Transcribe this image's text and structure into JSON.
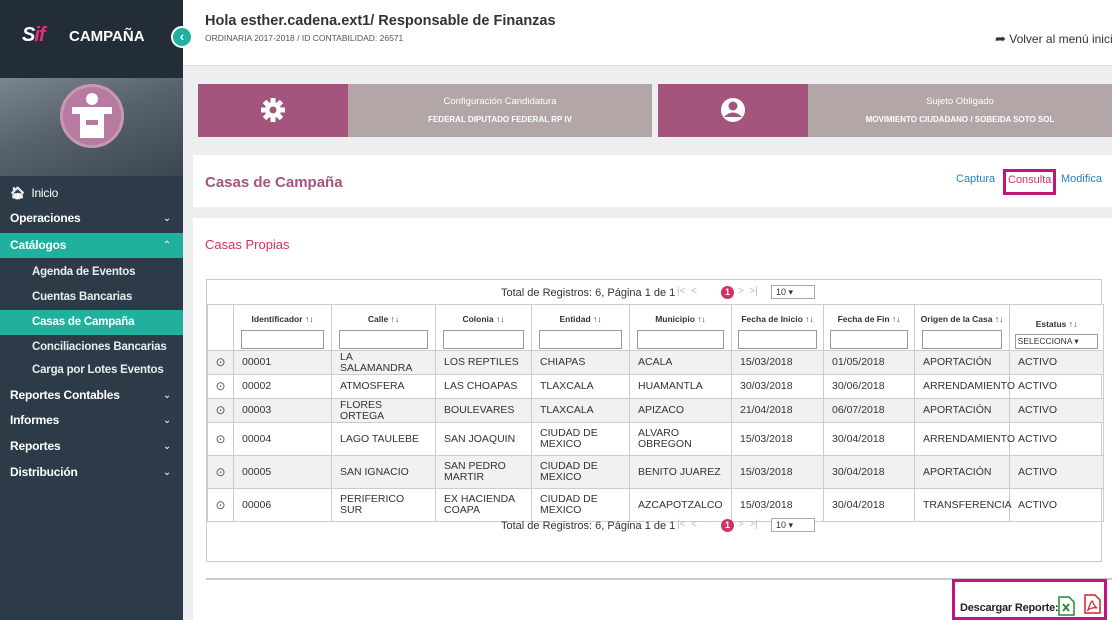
{
  "brand": {
    "logo": "SIF",
    "name": "CAMPAÑA",
    "collapse_icon": "‹"
  },
  "sidebar": {
    "items": [
      {
        "label": "Inicio",
        "icon": "home-icon"
      },
      {
        "label": "Operaciones"
      },
      {
        "label": "Catálogos",
        "active": true
      },
      {
        "label": "Reportes Contables"
      },
      {
        "label": "Informes"
      },
      {
        "label": "Reportes"
      },
      {
        "label": "Distribución"
      }
    ],
    "sub_items": [
      {
        "label": "Agenda de Eventos"
      },
      {
        "label": "Cuentas Bancarias"
      },
      {
        "label": "Casas de Campaña",
        "active": true
      },
      {
        "label": "Conciliaciones Bancarias"
      },
      {
        "label": "Carga por Lotes Eventos"
      }
    ],
    "chevron_down": "⌄",
    "chevron_up": "⌃"
  },
  "header": {
    "greeting": "Hola esther.cadena.ext1/ Responsable de Finanzas",
    "subtitle": "ORDINARIA 2017-2018 / ID CONTABILIDAD: 26571",
    "back": "Volver al menú inicio"
  },
  "cards": [
    {
      "title": "Configuración Candidatura",
      "value": "FEDERAL DIPUTADO FEDERAL RP IV",
      "icon": "gear-icon"
    },
    {
      "title": "Sujeto Obligado",
      "value": "MOVIMIENTO CIUDADANO / SOBEIDA SOTO SOL",
      "icon": "user-icon"
    }
  ],
  "page": {
    "title": "Casas de Campaña",
    "links": {
      "captura": "Captura",
      "consulta": "Consulta",
      "modifica": "Modifica"
    },
    "section": "Casas Propias"
  },
  "pager": {
    "text": "Total de Registros: 6, Página 1 de 1",
    "first": "|<",
    "prev": "<",
    "page": "1",
    "next": ">",
    "last": ">|",
    "per_page": "10"
  },
  "table": {
    "columns": [
      "Identificador",
      "Calle",
      "Colonia",
      "Entidad",
      "Municipio",
      "Fecha de Inicio",
      "Fecha de Fin",
      "Origen de la Casa",
      "Estatus"
    ],
    "sort_icon": "↑↓",
    "status_filter": "SELECCIONA",
    "rows": [
      [
        "00001",
        "LA SALAMANDRA",
        "LOS REPTILES",
        "CHIAPAS",
        "ACALA",
        "15/03/2018",
        "01/05/2018",
        "APORTACIÓN",
        "ACTIVO"
      ],
      [
        "00002",
        "ATMOSFERA",
        "LAS CHOAPAS",
        "TLAXCALA",
        "HUAMANTLA",
        "30/03/2018",
        "30/06/2018",
        "ARRENDAMIENTO",
        "ACTIVO"
      ],
      [
        "00003",
        "FLORES ORTEGA",
        "BOULEVARES",
        "TLAXCALA",
        "APIZACO",
        "21/04/2018",
        "06/07/2018",
        "APORTACIÓN",
        "ACTIVO"
      ],
      [
        "00004",
        "LAGO TAULEBE",
        "SAN JOAQUIN",
        "CIUDAD DE MEXICO",
        "ALVARO OBREGON",
        "15/03/2018",
        "30/04/2018",
        "ARRENDAMIENTO",
        "ACTIVO"
      ],
      [
        "00005",
        "SAN IGNACIO",
        "SAN PEDRO MARTIR",
        "CIUDAD DE MEXICO",
        "BENITO JUAREZ",
        "15/03/2018",
        "30/04/2018",
        "APORTACIÓN",
        "ACTIVO"
      ],
      [
        "00006",
        "PERIFERICO SUR",
        "EX HACIENDA COAPA",
        "CIUDAD DE MEXICO",
        "AZCAPOTZALCO",
        "15/03/2018",
        "30/04/2018",
        "TRANSFERENCIA",
        "ACTIVO"
      ]
    ]
  },
  "download": {
    "label": "Descargar Reporte:",
    "excel_icon": "excel-icon",
    "pdf_icon": "pdf-icon"
  },
  "colors": {
    "accent": "#1fb19e",
    "brand": "#a4557e",
    "highlight": "#c0147e",
    "sidebar": "#2d3b48"
  }
}
